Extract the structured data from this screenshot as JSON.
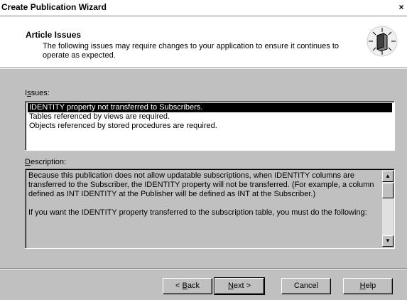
{
  "window": {
    "title": "Create Publication Wizard",
    "close_glyph": "×"
  },
  "header": {
    "title": "Article Issues",
    "description": "The following issues may require changes to your application to ensure it continues to operate as expected.",
    "icon": "wizard-book-icon"
  },
  "issues": {
    "label_first": "I",
    "label_mnemonic": "s",
    "label_rest": "sues:",
    "items": [
      {
        "label": "IDENTITY property not transferred to Subscribers.",
        "selected": true
      },
      {
        "label": "Tables referenced by views are required.",
        "selected": false
      },
      {
        "label": "Objects referenced by stored procedures are required.",
        "selected": false
      }
    ]
  },
  "description": {
    "label_mnemonic": "D",
    "label_rest": "escription:",
    "paragraph1": "Because this publication does not allow updatable subscriptions, when IDENTITY columns are transferred to the Subscriber, the IDENTITY property will not be transferred. (For example, a column defined as INT IDENTITY at the Publisher will be defined as INT at the Subscriber.)",
    "paragraph2": "If you want the IDENTITY property transferred to the subscription table, you must do the following:"
  },
  "buttons": {
    "back_prefix": "< ",
    "back_mnemonic": "B",
    "back_rest": "ack",
    "next_mnemonic": "N",
    "next_rest": "ext >",
    "cancel": "Cancel",
    "help_mnemonic": "H",
    "help_rest": "elp"
  }
}
